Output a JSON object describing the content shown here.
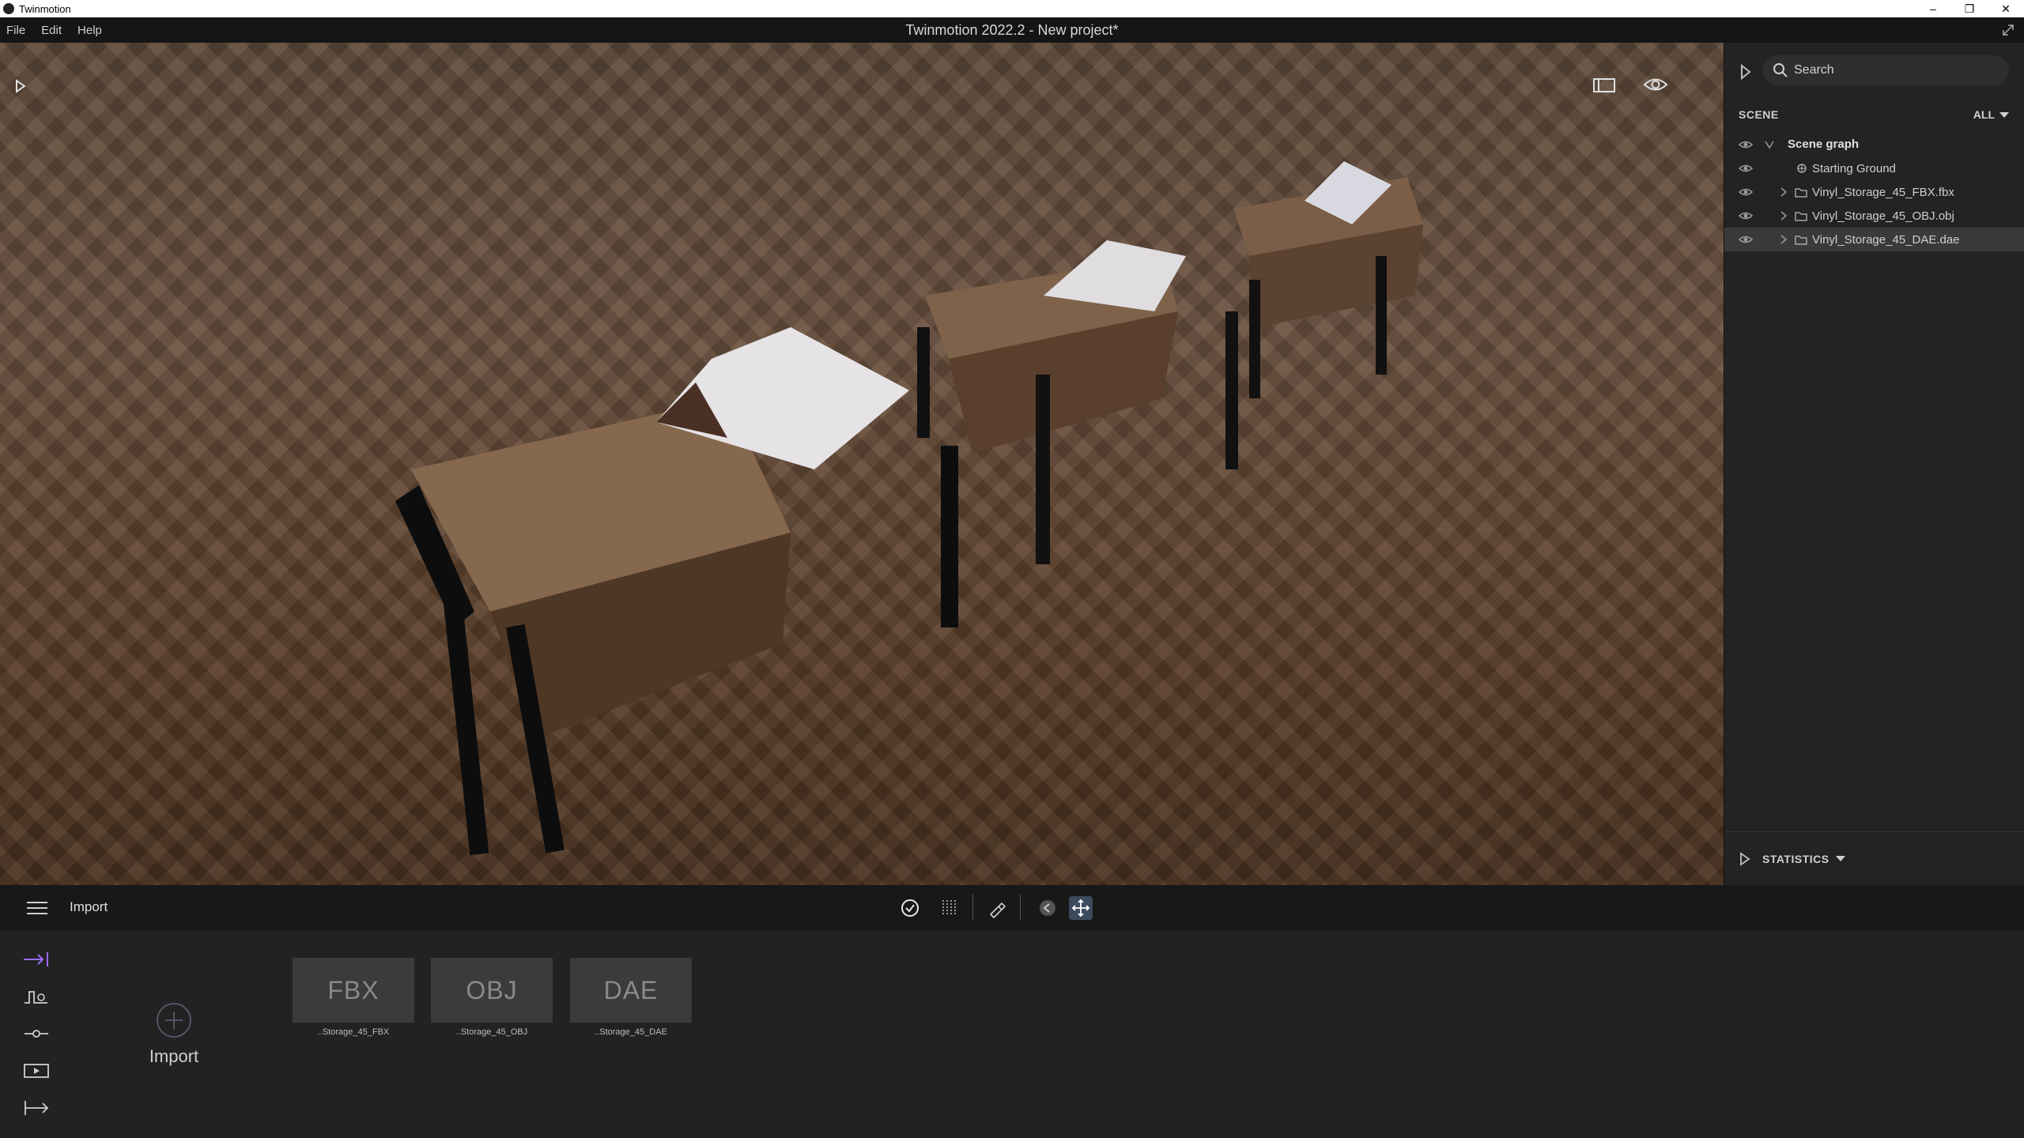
{
  "os_window": {
    "app_name": "Twinmotion",
    "controls": {
      "minimize": "–",
      "restore": "❐",
      "close": "✕"
    }
  },
  "menubar": {
    "items": [
      "File",
      "Edit",
      "Help"
    ],
    "title": "Twinmotion 2022.2 - New project*"
  },
  "right_panel": {
    "search_placeholder": "Search",
    "section_label": "SCENE",
    "filter_label": "ALL",
    "tree": [
      {
        "label": "Scene graph"
      },
      {
        "label": "Starting Ground"
      },
      {
        "label": "Vinyl_Storage_45_FBX.fbx"
      },
      {
        "label": "Vinyl_Storage_45_OBJ.obj"
      },
      {
        "label": "Vinyl_Storage_45_DAE.dae"
      }
    ],
    "statistics_label": "STATISTICS"
  },
  "toolbar": {
    "section_title": "Import"
  },
  "import_panel": {
    "import_label": "Import",
    "assets": [
      {
        "format": "FBX",
        "caption": "..Storage_45_FBX"
      },
      {
        "format": "OBJ",
        "caption": "..Storage_45_OBJ"
      },
      {
        "format": "DAE",
        "caption": "..Storage_45_DAE"
      }
    ]
  },
  "colors": {
    "accent_purple": "#9b6bff",
    "active_tool_bg": "#3d4a5c",
    "panel_bg": "#232323",
    "bottom_bg": "#222222"
  }
}
